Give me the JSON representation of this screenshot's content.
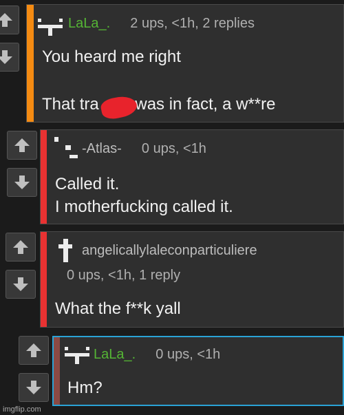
{
  "colors": {
    "accent_orange": "#f58b12",
    "accent_red": "#e83232",
    "accent_blue": "#2aa3d6",
    "accent_brown": "#8a4a44",
    "username_green": "#55b535",
    "redaction_red": "#e8232c"
  },
  "comments": [
    {
      "user": "LaLa_.",
      "stats": "2 ups, <1h, 2 replies",
      "lines": [
        "You heard me right",
        "That tra",
        "y was in fact, a w**re"
      ]
    },
    {
      "user": "-Atlas-",
      "stats": "0 ups, <1h",
      "lines": [
        "Called it.",
        "I motherfucking called it."
      ]
    },
    {
      "user": "angelicallylaleconparticuliere",
      "stats": "0 ups, <1h, 1 reply",
      "lines": [
        "What the f**k yall"
      ]
    },
    {
      "user": "LaLa_.",
      "stats": "0 ups, <1h",
      "lines": [
        "Hm?"
      ]
    }
  ],
  "icons": {
    "upvote": "arrow-up-icon",
    "downvote": "arrow-down-icon",
    "avatar": "pixel-avatar-icon"
  },
  "watermark": "imgflip.com"
}
